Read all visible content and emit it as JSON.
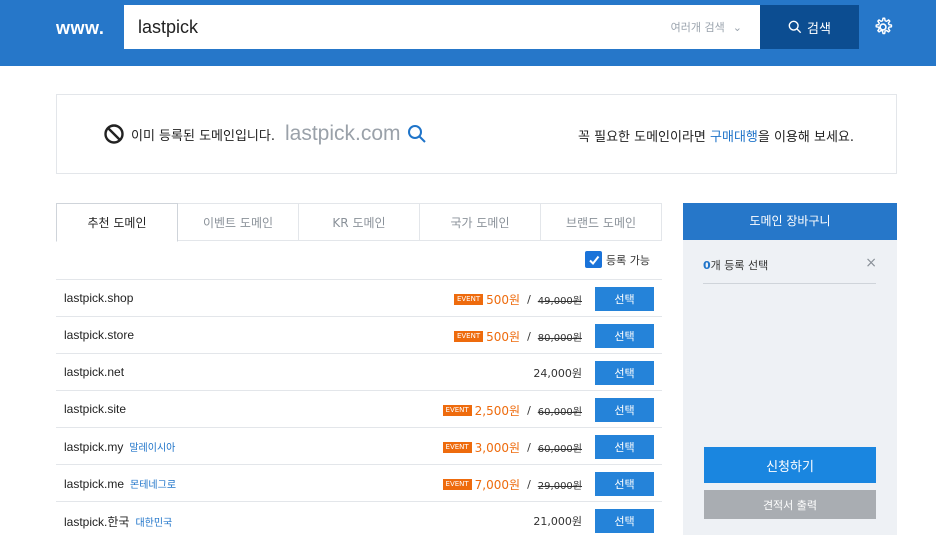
{
  "header": {
    "logo": "www.",
    "search_value": "lastpick",
    "multi_search_label": "여러개 검색",
    "search_button_label": "검색",
    "settings_icon": "gear-icon"
  },
  "notice": {
    "message": "이미 등록된 도메인입니다.",
    "domain": "lastpick.com",
    "right_prefix": "꼭 필요한 도메인이라면 ",
    "right_link": "구매대행",
    "right_suffix": "을 이용해 보세요."
  },
  "tabs": [
    {
      "label": "추천 도메인",
      "active": true
    },
    {
      "label": "이벤트 도메인",
      "active": false
    },
    {
      "label": "KR 도메인",
      "active": false
    },
    {
      "label": "국가 도메인",
      "active": false
    },
    {
      "label": "브랜드 도메인",
      "active": false
    }
  ],
  "filter": {
    "label": "등록 가능",
    "checked": true
  },
  "domains": [
    {
      "name": "lastpick.shop",
      "country": "",
      "event": "EVENT",
      "price": "500원",
      "original": "49,000원",
      "button": "선택"
    },
    {
      "name": "lastpick.store",
      "country": "",
      "event": "EVENT",
      "price": "500원",
      "original": "80,000원",
      "button": "선택"
    },
    {
      "name": "lastpick.net",
      "country": "",
      "event": "",
      "price": "24,000원",
      "original": "",
      "button": "선택"
    },
    {
      "name": "lastpick.site",
      "country": "",
      "event": "EVENT",
      "price": "2,500원",
      "original": "60,000원",
      "button": "선택"
    },
    {
      "name": "lastpick.my",
      "country": "말레이시아",
      "event": "EVENT",
      "price": "3,000원",
      "original": "60,000원",
      "button": "선택"
    },
    {
      "name": "lastpick.me",
      "country": "몬테네그로",
      "event": "EVENT",
      "price": "7,000원",
      "original": "29,000원",
      "button": "선택"
    },
    {
      "name": "lastpick.한국",
      "country": "대한민국",
      "event": "",
      "price": "21,000원",
      "original": "",
      "button": "선택"
    }
  ],
  "cart": {
    "title": "도메인 장바구니",
    "count": "0",
    "count_label": "개 등록 선택",
    "apply_label": "신청하기",
    "quote_label": "견적서 출력"
  },
  "colors": {
    "header_bg": "#2677c9",
    "search_button_bg": "#0c4d91",
    "event_orange": "#ee6b0d",
    "select_button_bg": "#2583d9",
    "link_blue": "#1f74c9"
  }
}
